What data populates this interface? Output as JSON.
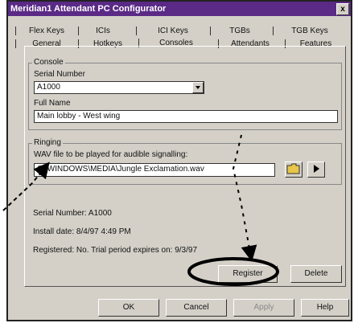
{
  "window": {
    "title": "Meridian1 Attendant PC Configurator",
    "close_label": "x"
  },
  "tabs_row1": [
    {
      "label": "Flex Keys"
    },
    {
      "label": "ICIs"
    },
    {
      "label": "ICI Keys"
    },
    {
      "label": "TGBs"
    },
    {
      "label": "TGB Keys"
    }
  ],
  "tabs_row2": [
    {
      "label": "General"
    },
    {
      "label": "Hotkeys"
    },
    {
      "label": "Consoles",
      "active": true
    },
    {
      "label": "Attendants"
    },
    {
      "label": "Features"
    }
  ],
  "console": {
    "group_label": "Console",
    "serial_label": "Serial Number",
    "serial_value": "A1000",
    "fullname_label": "Full Name",
    "fullname_value": "Main lobby - West wing"
  },
  "ringing": {
    "group_label": "Ringing",
    "wav_label": "WAV file to be played for audible signalling:",
    "wav_value": "C:\\WINDOWS\\MEDIA\\Jungle Exclamation.wav",
    "browse_icon": "folder-icon",
    "play_icon": "play-icon"
  },
  "info": {
    "serial_line": "Serial Number: A1000",
    "install_line": "Install date: 8/4/97 4:49 PM",
    "registered_line": "Registered: No. Trial period expires on: 9/3/97"
  },
  "buttons": {
    "register": "Register",
    "delete": "Delete",
    "ok": "OK",
    "cancel": "Cancel",
    "apply": "Apply",
    "help": "Help"
  },
  "colors": {
    "titlebar": "#5a2a86",
    "dialog_bg": "#d4d0c8",
    "annotation": "#000000"
  }
}
